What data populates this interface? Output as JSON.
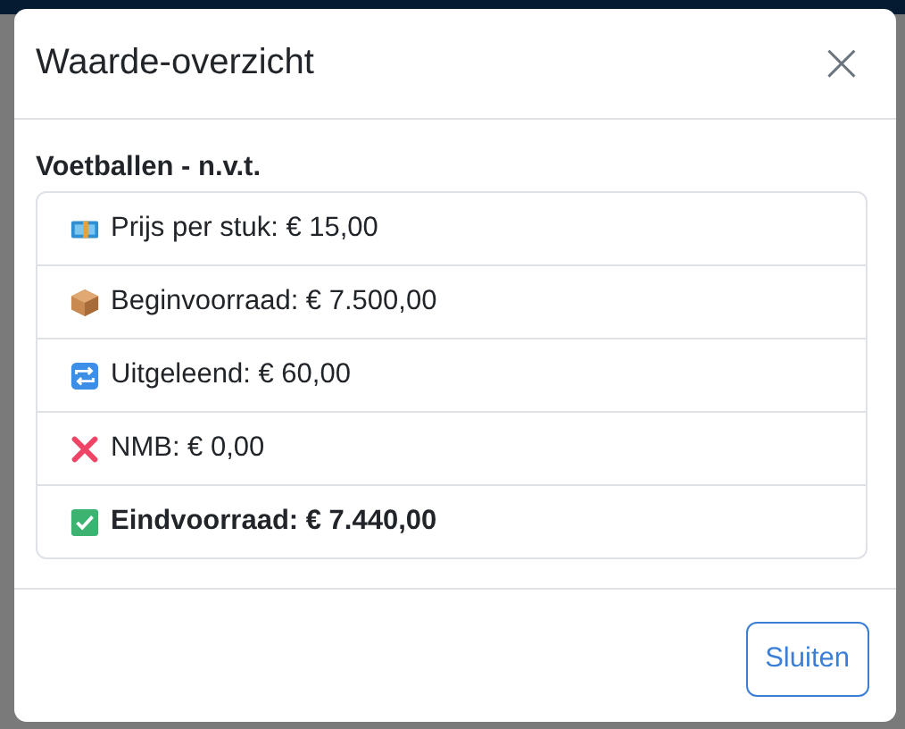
{
  "dialog": {
    "title": "Waarde-overzicht",
    "close_label": "×"
  },
  "section": {
    "heading": "Voetballen - n.v.t.",
    "rows": [
      {
        "kind": "money",
        "text": "Prijs per stuk: € 15,00",
        "emphasis": false
      },
      {
        "kind": "box",
        "text": "Beginvoorraad: € 7.500,00",
        "emphasis": false
      },
      {
        "kind": "repeat",
        "text": "Uitgeleend: € 60,00",
        "emphasis": false
      },
      {
        "kind": "cross",
        "text": "NMB: € 0,00",
        "emphasis": false
      },
      {
        "kind": "check",
        "text": "Eindvoorraad: € 7.440,00",
        "emphasis": true
      }
    ]
  },
  "buttons": [
    "Sluiten"
  ]
}
